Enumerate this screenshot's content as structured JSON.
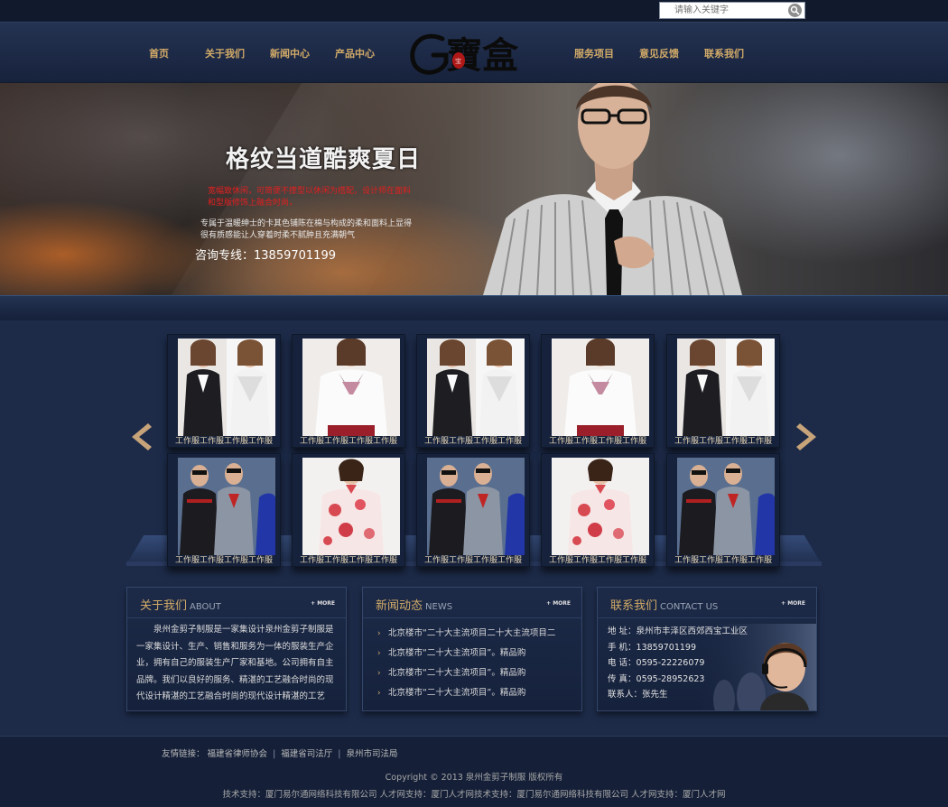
{
  "search": {
    "placeholder": "请输入关键字"
  },
  "nav": {
    "left": [
      "首页",
      "关于我们",
      "新闻中心",
      "产品中心"
    ],
    "right": [
      "服务项目",
      "意见反馈",
      "联系我们"
    ],
    "logo_text": "G寶盒"
  },
  "banner": {
    "title": "格纹当道酷爽夏日",
    "red_text": "宽幅致休闲，可简便不撑型以休闲为搭配，设计师在面料和型版修饰上融合时尚，",
    "desc": "专属于温暖绅士的卡其色铺陈在棉与构成的柔和面料上显得很有质感能让人穿着时柔不腻肿且充满朝气",
    "hotline": "咨询专线：13859701199"
  },
  "gallery": {
    "caption": "工作服工作服工作服工作服",
    "rows": [
      [
        "vest-duo",
        "shirt-scarf",
        "vest-duo",
        "shirt-scarf",
        "vest-duo"
      ],
      [
        "workwear-men",
        "qipao",
        "workwear-men",
        "qipao",
        "workwear-men"
      ]
    ],
    "left_arrow_icon": "chevron-left-icon",
    "right_arrow_icon": "chevron-right-icon"
  },
  "about": {
    "title": "关于我们",
    "title_en": "ABOUT",
    "more": "+ MORE",
    "text": "泉州金剪子制服是一家集设计泉州金剪子制服是一家集设计、生产、销售和服务为一体的服装生产企业，拥有自己的服装生产厂家和基地。公司拥有自主品牌。我们以良好的服务、精湛的工艺融合时尚的现代设计精湛的工艺融合时尚的现代设计精湛的工艺"
  },
  "news": {
    "title": "新闻动态",
    "title_en": "NEWS",
    "more": "+ MORE",
    "items": [
      "北京楼市“二十大主流项目二十大主流项目二",
      "北京楼市“二十大主流项目”。精品购",
      "北京楼市“二十大主流项目”。精品购",
      "北京楼市“二十大主流项目”。精品购"
    ]
  },
  "contact": {
    "title": "联系我们",
    "title_en": "CONTACT US",
    "more": "+ MORE",
    "rows": [
      "地  址：泉州市丰泽区西郊西宝工业区",
      "手  机：13859701199",
      "电  话：0595-22226079",
      "传  真：0595-28952623",
      "联系人：张先生"
    ]
  },
  "footer": {
    "links_label": "友情链接：",
    "links": [
      "福建省律师协会",
      "福建省司法厅",
      "泉州市司法局"
    ],
    "copyright": "Copyright © 2013 泉州金剪子制服 版权所有",
    "support": "技术支持：厦门易尔通网络科技有限公司 人才网支持：厦门人才网技术支持：厦门易尔通网络科技有限公司 人才网支持：厦门人才网"
  },
  "colors": {
    "accent_gold": "#d2ab68",
    "page_bg": "#1d2b49",
    "banner_red": "#e22020"
  }
}
